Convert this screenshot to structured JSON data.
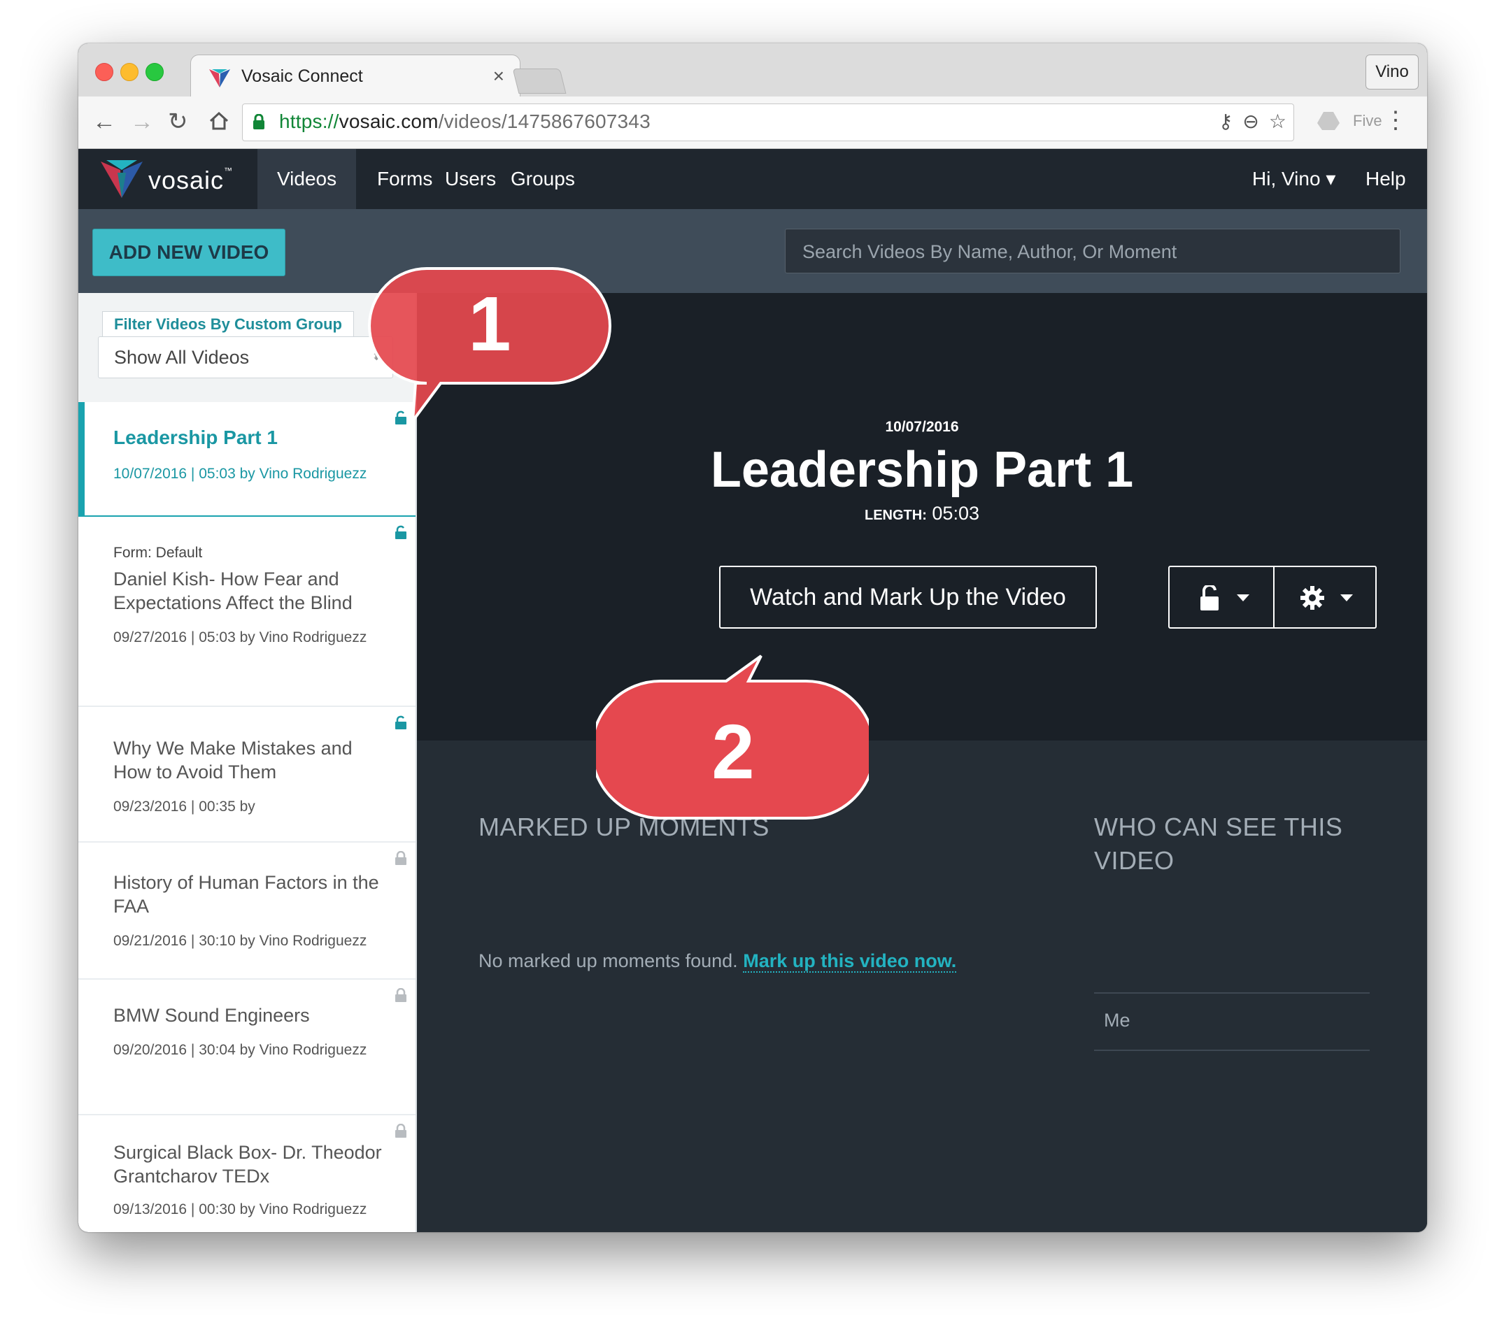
{
  "browser": {
    "tab_title": "Vosaic Connect",
    "tab_close": "×",
    "profile": "Vino",
    "url_scheme": "https://",
    "url_host": "vosaic.com",
    "url_path": "/videos/1475867607343",
    "extension_label": "Five"
  },
  "app": {
    "logo_text": "vosaic",
    "logo_tm": "™",
    "nav": [
      "Videos",
      "Forms",
      "Users",
      "Groups"
    ],
    "active_nav": "Videos",
    "user_menu": "Hi, Vino ▾",
    "help": "Help",
    "add_button": "ADD NEW VIDEO",
    "search_placeholder": "Search Videos By Name, Author, Or Moment",
    "accent_color": "#3ebcc8"
  },
  "sidebar": {
    "filter_label": "Filter Videos By Custom Group",
    "filter_value": "Show All Videos",
    "videos": [
      {
        "form": "",
        "title": "Leadership Part 1",
        "meta": "10/07/2016 | 05:03 by Vino Rodriguezz",
        "lock": "open-teal",
        "active": true
      },
      {
        "form": "Form: Default",
        "title": "Daniel Kish- How Fear and Expectations Affect the Blind",
        "meta": "09/27/2016 | 05:03 by Vino Rodriguezz",
        "lock": "open-teal",
        "active": false
      },
      {
        "form": "",
        "title": "Why We Make Mistakes and How to Avoid Them",
        "meta": "09/23/2016 | 00:35 by",
        "lock": "open-teal",
        "active": false
      },
      {
        "form": "",
        "title": "History of Human Factors in the FAA",
        "meta": "09/21/2016 | 30:10 by Vino Rodriguezz",
        "lock": "closed-gray",
        "active": false
      },
      {
        "form": "",
        "title": "BMW Sound Engineers",
        "meta": "09/20/2016 | 30:04 by Vino Rodriguezz",
        "lock": "closed-gray",
        "active": false
      },
      {
        "form": "",
        "title": "Surgical Black Box- Dr. Theodor Grantcharov TEDx",
        "meta": "09/13/2016 | 00:30 by Vino Rodriguezz",
        "lock": "closed-gray",
        "active": false
      }
    ]
  },
  "main": {
    "date": "10/07/2016",
    "title": "Leadership Part 1",
    "length_label": "LENGTH:",
    "length_value": "05:03",
    "watch_button": "Watch and Mark Up the Video",
    "moments_heading": "MARKED UP MOMENTS",
    "no_moments_text": "No marked up moments found.",
    "mark_up_link": "Mark up this video now.",
    "who_heading_line1": "WHO CAN SEE THIS",
    "who_heading_line2": "VIDEO",
    "who_entries": [
      "Me"
    ]
  },
  "callouts": {
    "one": "1",
    "two": "2",
    "color": "#e5484f"
  }
}
